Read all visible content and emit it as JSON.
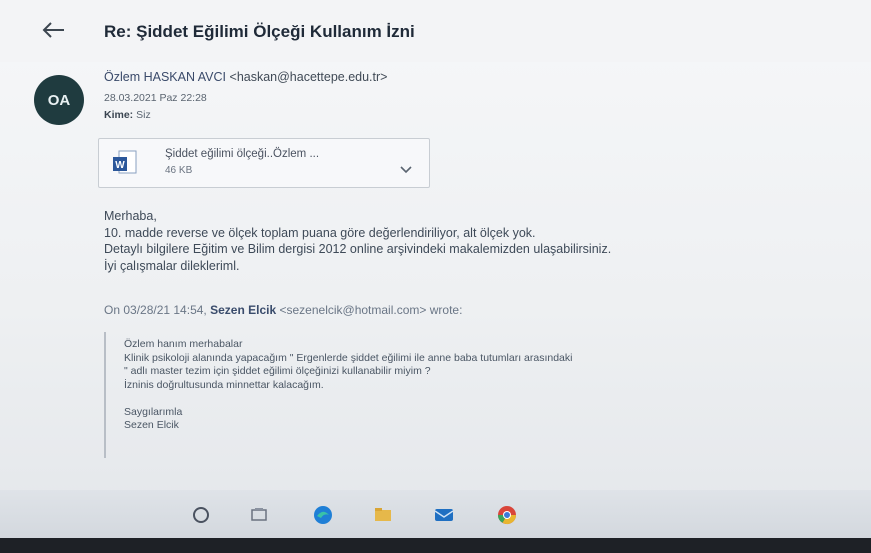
{
  "header": {
    "back_icon": "back-arrow-icon",
    "subject": "Re: Şiddet Eğilimi Ölçeği Kullanım İzni"
  },
  "message": {
    "avatar_initials": "OA",
    "sender_name": "Özlem HASKAN AVCI",
    "sender_email": "<haskan@hacettepe.edu.tr>",
    "date": "28.03.2021 Paz 22:28",
    "to_label": "Kime:",
    "to_value": "Siz"
  },
  "attachment": {
    "icon": "word-doc-icon",
    "name": "Şiddet eğilimi ölçeği..Özlem ...",
    "size": "46 KB",
    "menu_icon": "chevron-down-icon"
  },
  "body": {
    "lines": [
      "Merhaba,",
      "10. madde reverse ve ölçek toplam puana göre değerlendiriliyor, alt ölçek yok.",
      "Detaylı bilgilere Eğitim ve Bilim dergisi 2012 online arşivindeki makalemizden ulaşabilirsiniz.",
      "İyi çalışmalar dilekleriml."
    ]
  },
  "quote_header": {
    "prefix": "On 03/28/21 14:54,",
    "name": "Sezen Elcik",
    "suffix": "<sezenelcik@hotmail.com> wrote:"
  },
  "quote": {
    "lines": [
      "Özlem hanım merhabalar",
      "Klinik psikoloji alanında yapacağım \" Ergenlerde şiddet eğilimi ile anne baba tutumları arasındaki",
      "\" adlı master tezim için şiddet eğilimi ölçeğinizi kullanabilir miyim ?",
      "İzninis doğrultusunda minnettar kalacağım.",
      "",
      "Saygılarımla",
      "Sezen Elcik"
    ]
  },
  "taskbar": {
    "icons": [
      "search-icon",
      "task-view-icon",
      "edge-icon",
      "file-explorer-icon",
      "mail-icon",
      "chrome-icon"
    ]
  }
}
